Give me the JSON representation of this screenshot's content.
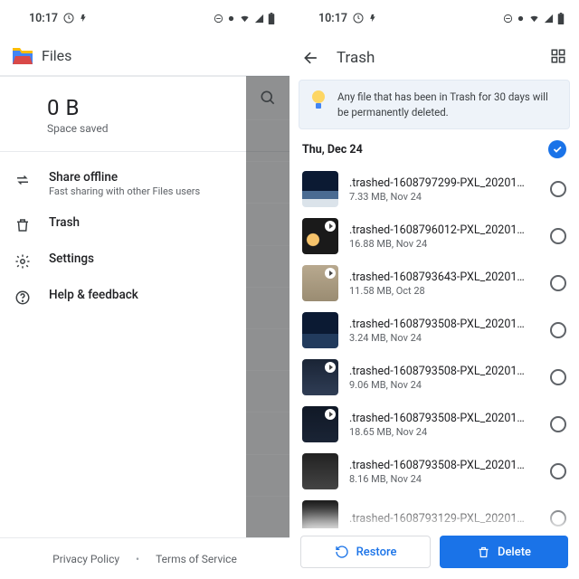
{
  "status_time": "10:17",
  "left": {
    "app_title": "Files",
    "space_value": "0 B",
    "space_label": "Space saved",
    "menu": [
      {
        "icon": "swap-icon",
        "title": "Share offline",
        "sub": "Fast sharing with other Files users"
      },
      {
        "icon": "trash-icon",
        "title": "Trash"
      },
      {
        "icon": "gear-icon",
        "title": "Settings"
      },
      {
        "icon": "help-icon",
        "title": "Help & feedback"
      }
    ],
    "footer_privacy": "Privacy Policy",
    "footer_terms": "Terms of Service"
  },
  "right": {
    "title": "Trash",
    "banner": "Any file that has been in Trash for 30 days will be permanently deleted.",
    "date_header": "Thu, Dec 24",
    "files": [
      {
        "name": ".trashed-1608797299-PXL_20201…",
        "meta": "7.33 MB, Nov 24",
        "thumb": "t0",
        "video": false
      },
      {
        "name": ".trashed-1608796012-PXL_20201…",
        "meta": "16.88 MB, Nov 24",
        "thumb": "t1",
        "video": true
      },
      {
        "name": ".trashed-1608793643-PXL_20201…",
        "meta": "11.58 MB, Oct 28",
        "thumb": "t2",
        "video": true
      },
      {
        "name": ".trashed-1608793508-PXL_20201…",
        "meta": "3.24 MB, Nov 24",
        "thumb": "t3",
        "video": false
      },
      {
        "name": ".trashed-1608793508-PXL_20201…",
        "meta": "9.06 MB, Nov 24",
        "thumb": "t4",
        "video": true
      },
      {
        "name": ".trashed-1608793508-PXL_20201…",
        "meta": "18.65 MB, Nov 24",
        "thumb": "t5",
        "video": true
      },
      {
        "name": ".trashed-1608793508-PXL_20201…",
        "meta": "8.16 MB, Nov 24",
        "thumb": "t6",
        "video": false
      },
      {
        "name": ".trashed-1608793129-PXL_20201…",
        "meta": "",
        "thumb": "t7",
        "video": false
      }
    ],
    "restore_label": "Restore",
    "delete_label": "Delete"
  }
}
